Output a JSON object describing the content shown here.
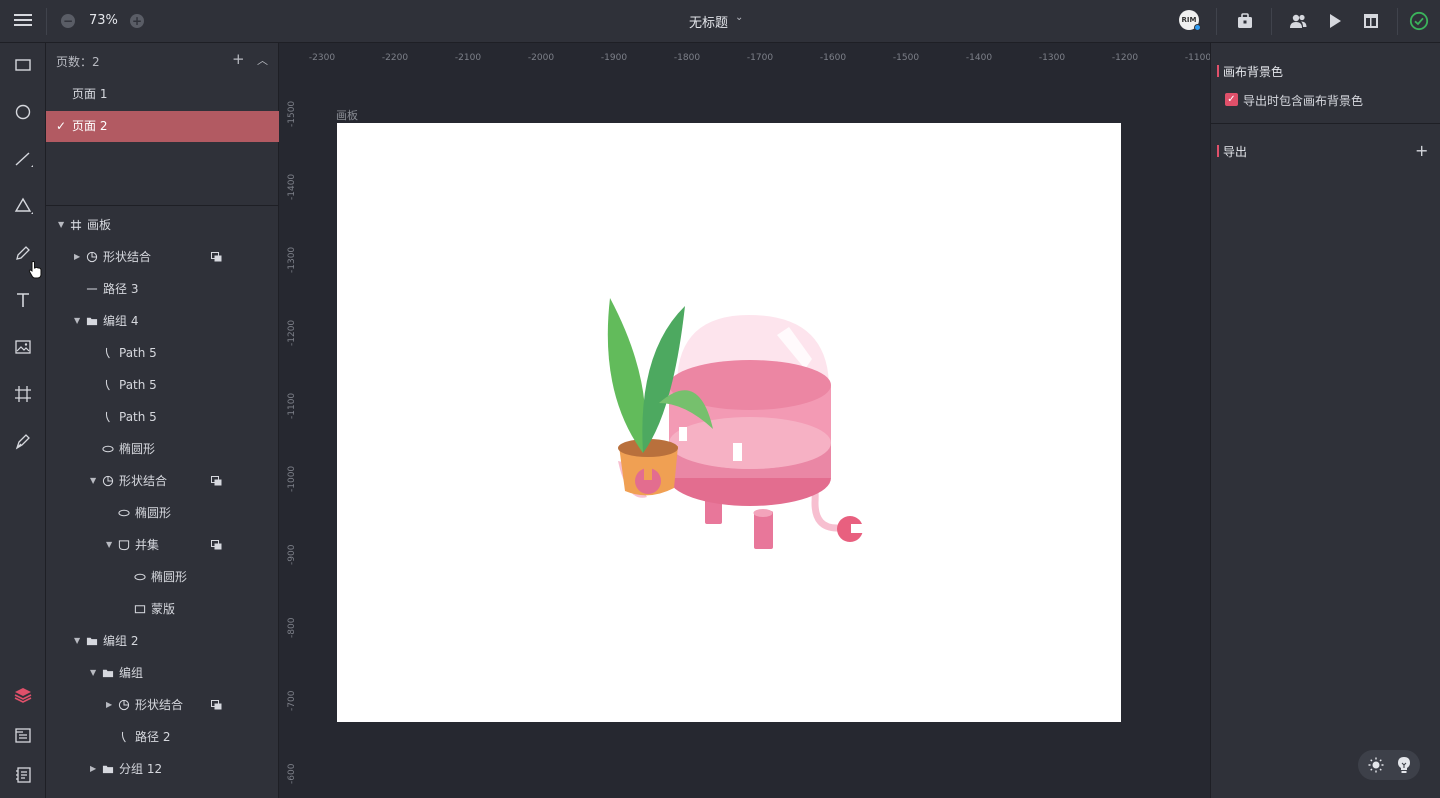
{
  "topbar": {
    "zoom": "73%",
    "title": "无标题",
    "avatar_text": "RIM"
  },
  "pages": {
    "header": "页数：2",
    "add": "+",
    "items": [
      {
        "label": "页面 1",
        "active": false
      },
      {
        "label": "页面 2",
        "active": true
      }
    ]
  },
  "layers": [
    {
      "name": "画板",
      "icon": "artboard-icon",
      "level": 0,
      "caret": "open"
    },
    {
      "name": "形状结合",
      "icon": "shape-combine-icon",
      "level": 1,
      "caret": "closed",
      "mask": true
    },
    {
      "name": "路径 3",
      "icon": "line-path-icon",
      "level": 1,
      "caret": "none"
    },
    {
      "name": "编组 4",
      "icon": "folder-icon",
      "level": 1,
      "caret": "open"
    },
    {
      "name": "Path 5",
      "icon": "path-icon",
      "level": 2,
      "caret": "none"
    },
    {
      "name": "Path 5",
      "icon": "path-icon",
      "level": 2,
      "caret": "none"
    },
    {
      "name": "Path 5",
      "icon": "path-icon",
      "level": 2,
      "caret": "none"
    },
    {
      "name": "椭圆形",
      "icon": "ellipse-icon",
      "level": 2,
      "caret": "none"
    },
    {
      "name": "形状结合",
      "icon": "shape-combine-icon",
      "level": 2,
      "caret": "open",
      "mask": true
    },
    {
      "name": "椭圆形",
      "icon": "ellipse-icon",
      "level": 3,
      "caret": "none"
    },
    {
      "name": "并集",
      "icon": "union-icon",
      "level": 3,
      "caret": "open",
      "mask": true
    },
    {
      "name": "椭圆形",
      "icon": "ellipse-icon",
      "level": 4,
      "caret": "none"
    },
    {
      "name": "蒙版",
      "icon": "rectangle-icon",
      "level": 4,
      "caret": "none"
    },
    {
      "name": "编组 2",
      "icon": "folder-icon",
      "level": 1,
      "caret": "open"
    },
    {
      "name": "编组",
      "icon": "folder-icon",
      "level": 2,
      "caret": "open"
    },
    {
      "name": "形状结合",
      "icon": "shape-combine-icon",
      "level": 3,
      "caret": "closed",
      "mask": true
    },
    {
      "name": "路径 2",
      "icon": "path-icon",
      "level": 3,
      "caret": "none"
    },
    {
      "name": "分组 12",
      "icon": "folder-icon",
      "level": 2,
      "caret": "closed"
    }
  ],
  "canvas": {
    "ruler_h": [
      "-2300",
      "-2200",
      "-2100",
      "-2000",
      "-1900",
      "-1800",
      "-1700",
      "-1600",
      "-1500",
      "-1400",
      "-1300",
      "-1200",
      "-1100"
    ],
    "ruler_v": [
      "-1500",
      "-1400",
      "-1300",
      "-1200",
      "-1100",
      "-1000",
      "-900",
      "-800",
      "-700",
      "-600"
    ],
    "artboard_label": "画板"
  },
  "inspector": {
    "bg_section": "画布背景色",
    "bg_checkbox": "导出时包含画布背景色",
    "export_section": "导出",
    "export_add": "+"
  },
  "colors": {
    "accent": "#e0506a",
    "active_page": "#b25a62",
    "panel": "#2f3139",
    "canvas": "#262830",
    "ok": "#3bb35b"
  }
}
